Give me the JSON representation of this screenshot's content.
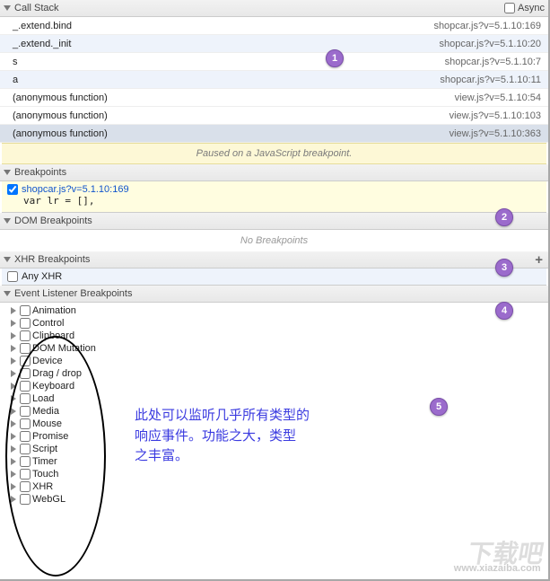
{
  "callstack": {
    "title": "Call Stack",
    "async_label": "Async",
    "frames": [
      {
        "fn": "_.extend.bind",
        "loc": "shopcar.js?v=5.1.10:169",
        "sel": false
      },
      {
        "fn": "_.extend._init",
        "loc": "shopcar.js?v=5.1.10:20",
        "sel": true
      },
      {
        "fn": "s",
        "loc": "shopcar.js?v=5.1.10:7",
        "sel": false
      },
      {
        "fn": "a",
        "loc": "shopcar.js?v=5.1.10:11",
        "sel": true
      },
      {
        "fn": "(anonymous function)",
        "loc": "view.js?v=5.1.10:54",
        "sel": false
      },
      {
        "fn": "(anonymous function)",
        "loc": "view.js?v=5.1.10:103",
        "sel": false
      },
      {
        "fn": "(anonymous function)",
        "loc": "view.js?v=5.1.10:363",
        "sel": false
      }
    ],
    "paused_msg": "Paused on a JavaScript breakpoint."
  },
  "breakpoints": {
    "title": "Breakpoints",
    "items": [
      {
        "label": "shopcar.js?v=5.1.10:169",
        "code": "var lr = [],"
      }
    ]
  },
  "dom_bp": {
    "title": "DOM Breakpoints",
    "empty_msg": "No Breakpoints"
  },
  "xhr_bp": {
    "title": "XHR Breakpoints",
    "anyxhr_label": "Any XHR"
  },
  "ev_bp": {
    "title": "Event Listener Breakpoints",
    "categories": [
      "Animation",
      "Control",
      "Clipboard",
      "DOM Mutation",
      "Device",
      "Drag / drop",
      "Keyboard",
      "Load",
      "Media",
      "Mouse",
      "Promise",
      "Script",
      "Timer",
      "Touch",
      "XHR",
      "WebGL"
    ]
  },
  "notes": {
    "n1": "1",
    "n2": "2",
    "n3": "3",
    "n4": "4",
    "n5": "5",
    "chinese": "此处可以监听几乎所有类型的\n响应事件。功能之大，类型\n之丰富。"
  },
  "watermark": {
    "big": "下载吧",
    "small": "www.xiazaiba.com"
  }
}
